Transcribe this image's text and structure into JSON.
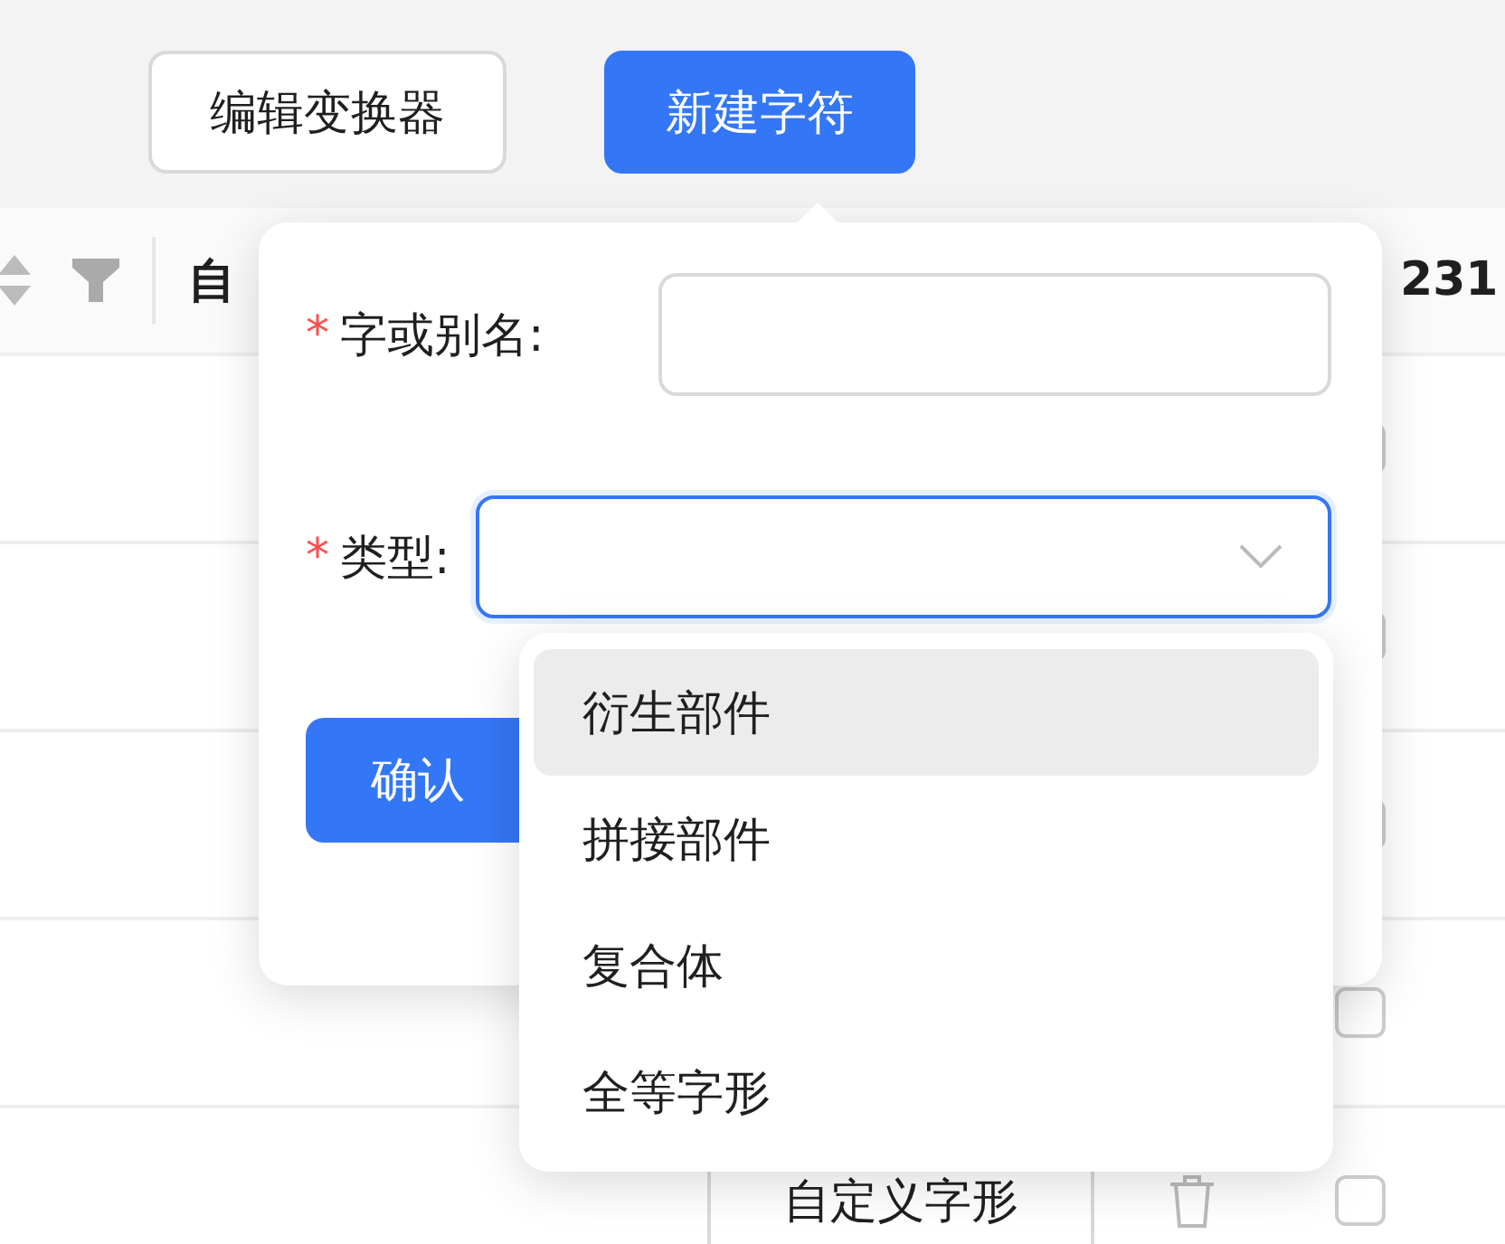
{
  "toolbar": {
    "buttons": [
      {
        "label": "编辑变换器",
        "kind": "default"
      },
      {
        "label": "新建字符",
        "kind": "primary"
      }
    ]
  },
  "table": {
    "header": {
      "column_1": "自",
      "column_2": "231"
    },
    "rows": [
      {
        "checked": false
      },
      {
        "checked": false
      },
      {
        "checked": false
      },
      {
        "checked": false
      },
      {
        "button": "自定义字形",
        "checked": false
      }
    ]
  },
  "popover": {
    "fields": [
      {
        "required_mark": "*",
        "label": "字或别名:",
        "kind": "input",
        "focused": false
      },
      {
        "required_mark": "*",
        "label": "类型:",
        "kind": "select",
        "focused": true
      }
    ],
    "submit": "确认"
  },
  "dropdown": {
    "options": [
      {
        "label": "衍生部件",
        "selected": true
      },
      {
        "label": "拼接部件",
        "selected": false
      },
      {
        "label": "复合体",
        "selected": false
      },
      {
        "label": "全等字形",
        "selected": false
      }
    ]
  }
}
